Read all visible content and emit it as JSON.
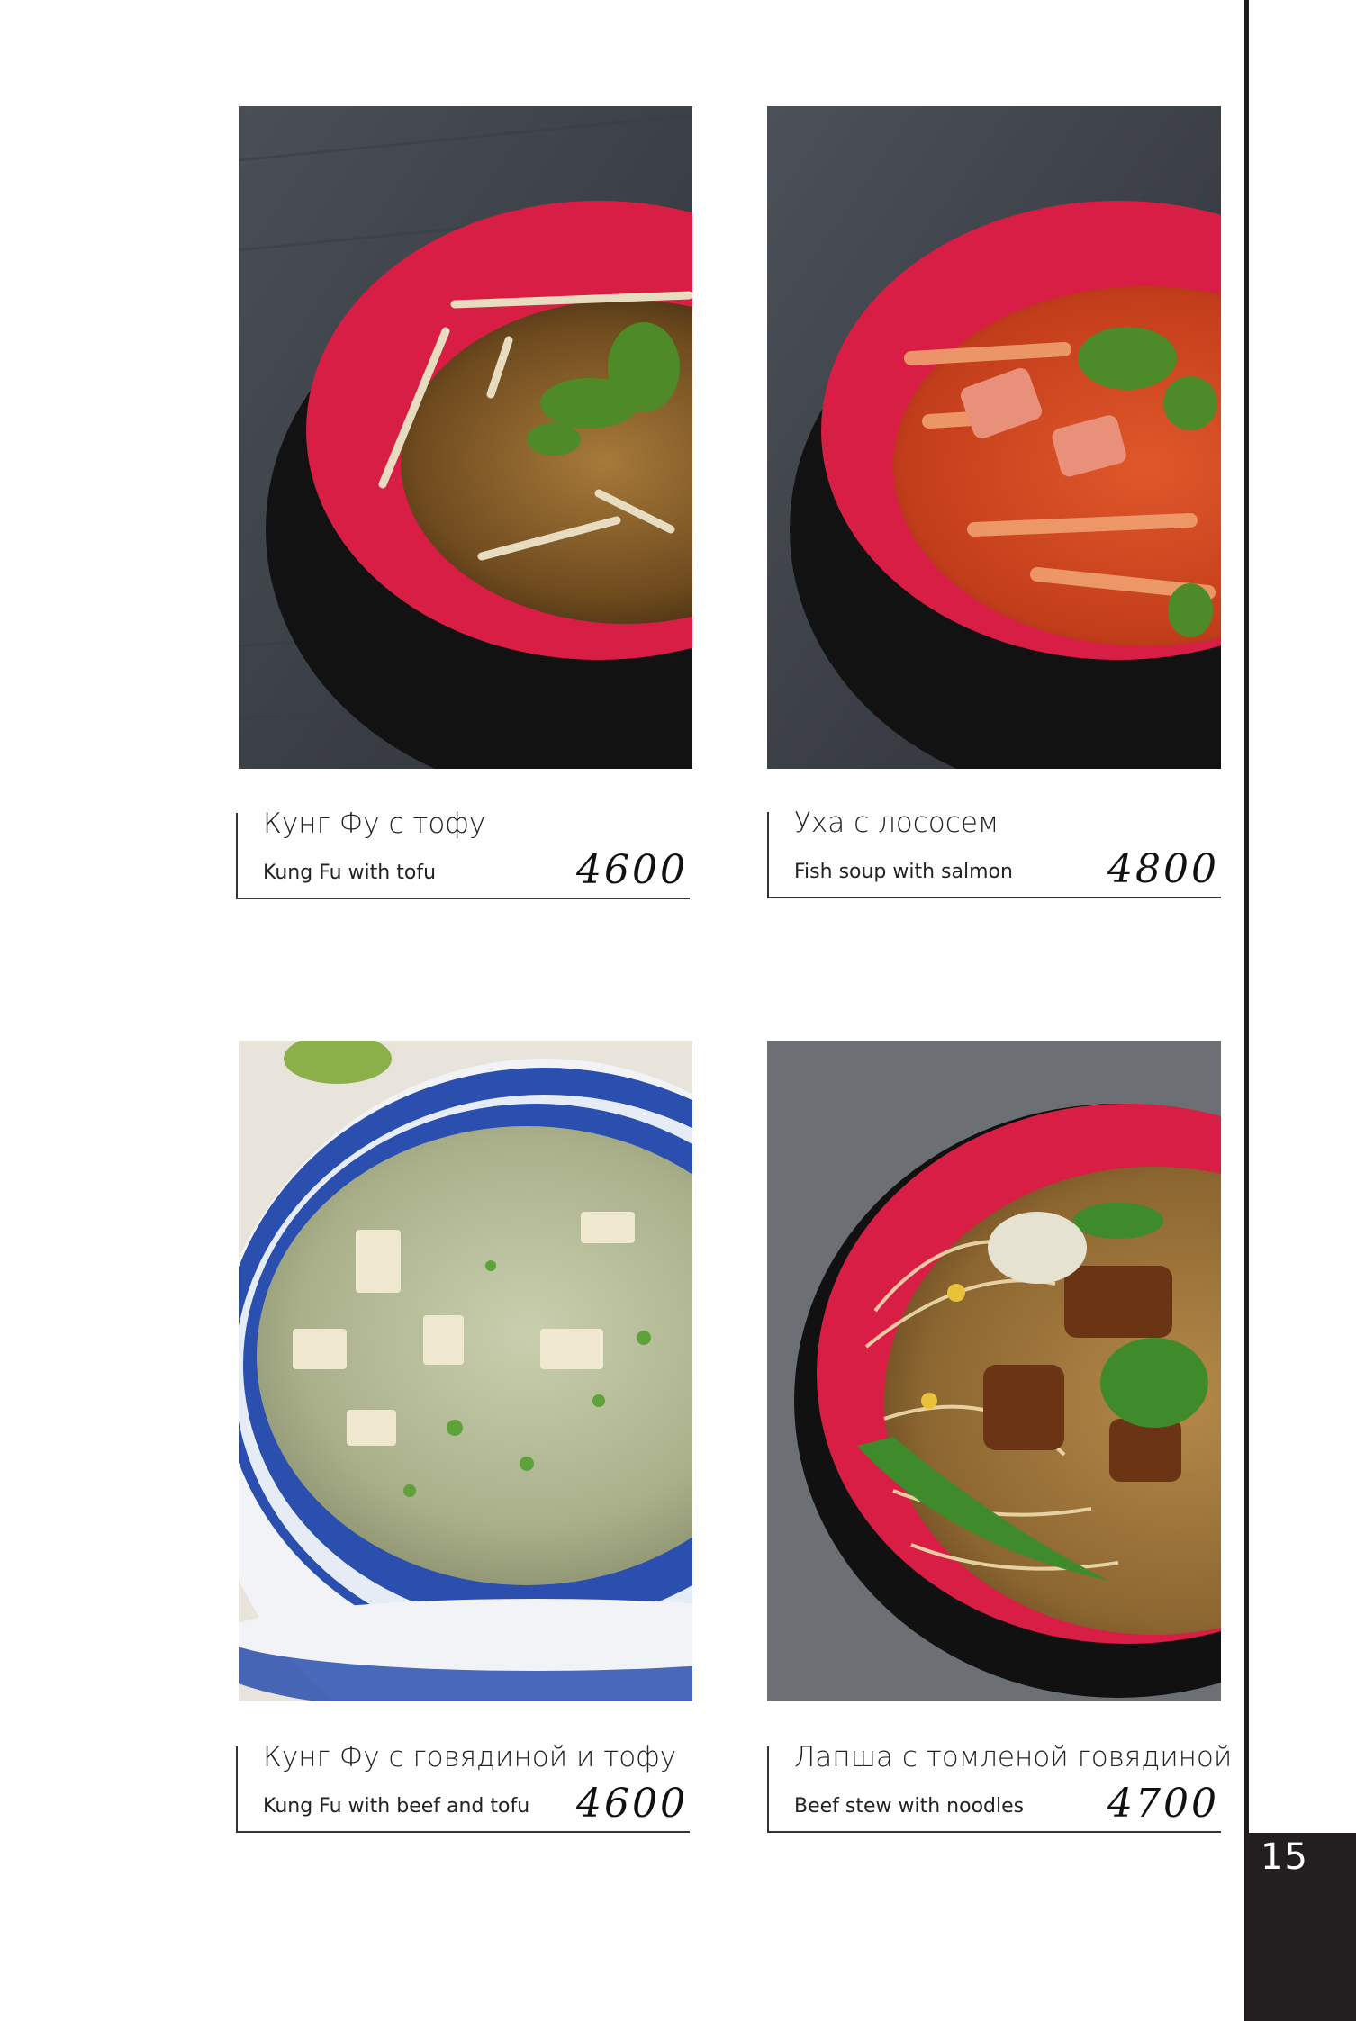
{
  "page_number": "15",
  "items": [
    {
      "name_ru": "Кунг Фу с тофу",
      "name_en": "Kung Fu with tofu",
      "price": "4600",
      "photo": "soup-kung-fu-tofu-photo"
    },
    {
      "name_ru": "Уха с лососем",
      "name_en": "Fish soup with salmon",
      "price": "4800",
      "photo": "fish-soup-salmon-photo"
    },
    {
      "name_ru": "Кунг Фу с говядиной и тофу",
      "name_en": "Kung Fu with beef and tofu",
      "price": "4600",
      "photo": "soup-kung-fu-beef-tofu-photo"
    },
    {
      "name_ru": "Лапша с томленой говядиной",
      "name_en": "Beef stew with noodles",
      "price": "4700",
      "photo": "beef-noodle-soup-photo"
    }
  ]
}
